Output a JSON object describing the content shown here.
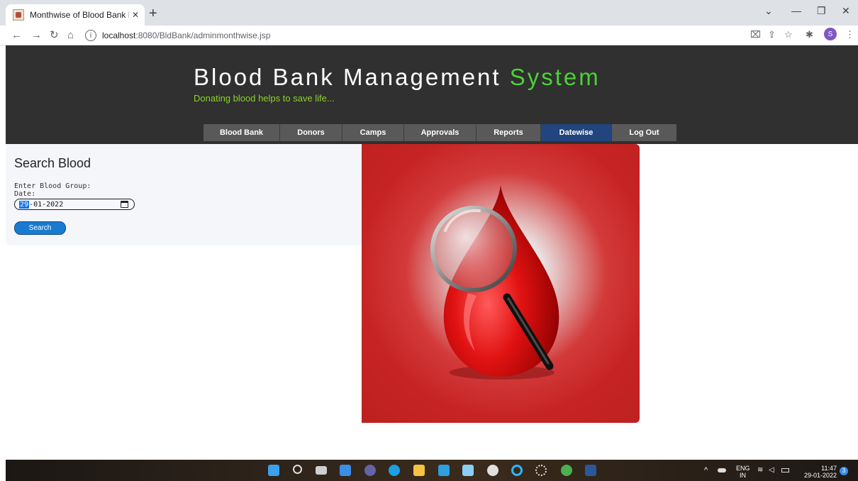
{
  "browser": {
    "tab_title": "Monthwise of Blood Bank Manag",
    "url_host": "localhost",
    "url_path": ":8080/BldBank/adminmonthwise.jsp"
  },
  "header": {
    "title_main": "Blood Bank Management",
    "title_accent": "System",
    "tagline": "Donating blood helps to save life..."
  },
  "menu": {
    "items": [
      {
        "label": "Blood Bank"
      },
      {
        "label": "Donors"
      },
      {
        "label": "Camps"
      },
      {
        "label": "Approvals"
      },
      {
        "label": "Reports"
      },
      {
        "label": "Datewise",
        "active": true
      },
      {
        "label": "Log Out"
      }
    ]
  },
  "search": {
    "title": "Search Blood",
    "blood_group_label": "Enter Blood Group:",
    "date_label": "Date:",
    "date_day": "29",
    "date_rest": "-01-2022",
    "button_label": "Search"
  },
  "taskbar": {
    "lang": "ENG",
    "region": "IN",
    "time": "11:47",
    "date": "29-01-2022",
    "notifications": "3"
  },
  "colors": {
    "header_bg": "#2f302f",
    "accent_green": "#4cd137",
    "tagline_green": "#8bd22a",
    "menu_bg": "#595959",
    "menu_active": "#224580",
    "button_blue": "#1a7ad0",
    "hero_red": "#c62424"
  },
  "icons": {
    "browser_nav": [
      "back-arrow-icon",
      "forward-arrow-icon",
      "reload-icon",
      "home-icon",
      "info-icon"
    ],
    "hero": [
      "blood-drop-icon",
      "magnifier-icon"
    ]
  },
  "user": {
    "avatar_initial": "S"
  }
}
